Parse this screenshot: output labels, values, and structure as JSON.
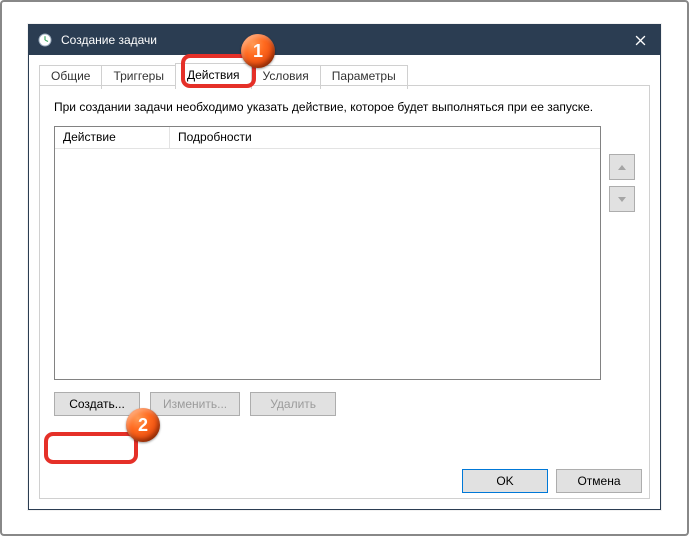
{
  "window": {
    "title": "Создание задачи"
  },
  "tabs": {
    "general": "Общие",
    "triggers": "Триггеры",
    "actions": "Действия",
    "conditions": "Условия",
    "settings": "Параметры"
  },
  "panel": {
    "description": "При создании задачи необходимо указать действие, которое будет выполняться при ее запуске.",
    "columns": {
      "action": "Действие",
      "details": "Подробности"
    },
    "buttons": {
      "create": "Создать...",
      "edit": "Изменить...",
      "delete": "Удалить"
    }
  },
  "dialog_buttons": {
    "ok": "OK",
    "cancel": "Отмена"
  },
  "markers": {
    "one": "1",
    "two": "2"
  }
}
